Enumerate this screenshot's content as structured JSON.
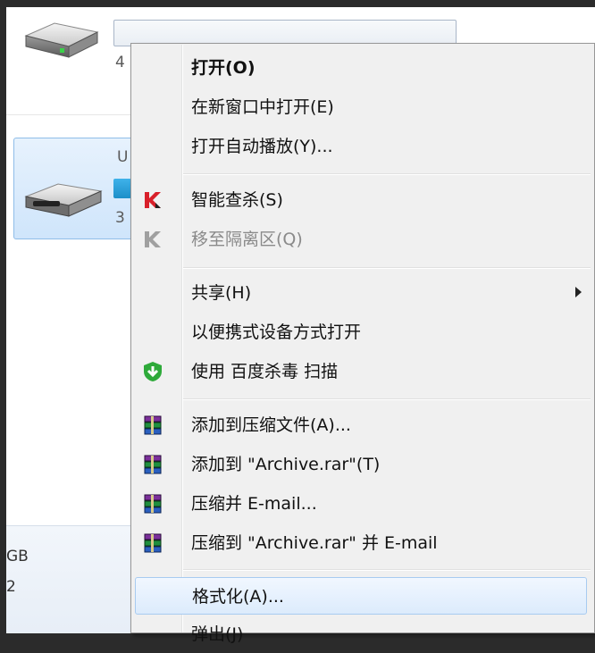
{
  "explorer": {
    "drive1_size_text": "4",
    "drive2_name_text": "U",
    "drive2_size_text": "3",
    "bottom_text_1": "GB",
    "bottom_text_2": "2"
  },
  "menu": {
    "items": [
      {
        "label": "打开(O)"
      },
      {
        "label": "在新窗口中打开(E)"
      },
      {
        "label": "打开自动播放(Y)..."
      },
      {
        "label": "智能查杀(S)"
      },
      {
        "label": "移至隔离区(Q)"
      },
      {
        "label": "共享(H)"
      },
      {
        "label": "以便携式设备方式打开"
      },
      {
        "label": "使用 百度杀毒 扫描"
      },
      {
        "label": "添加到压缩文件(A)..."
      },
      {
        "label": "添加到 \"Archive.rar\"(T)"
      },
      {
        "label": "压缩并 E-mail..."
      },
      {
        "label": "压缩到 \"Archive.rar\" 并 E-mail"
      },
      {
        "label": "格式化(A)..."
      },
      {
        "label": "弹出(J)"
      }
    ]
  },
  "colors": {
    "kaspersky_red": "#d8202a",
    "kaspersky_gray": "#a0a0a0",
    "shield_green": "#2eaa3a",
    "hover_border": "#a8cbf0"
  }
}
